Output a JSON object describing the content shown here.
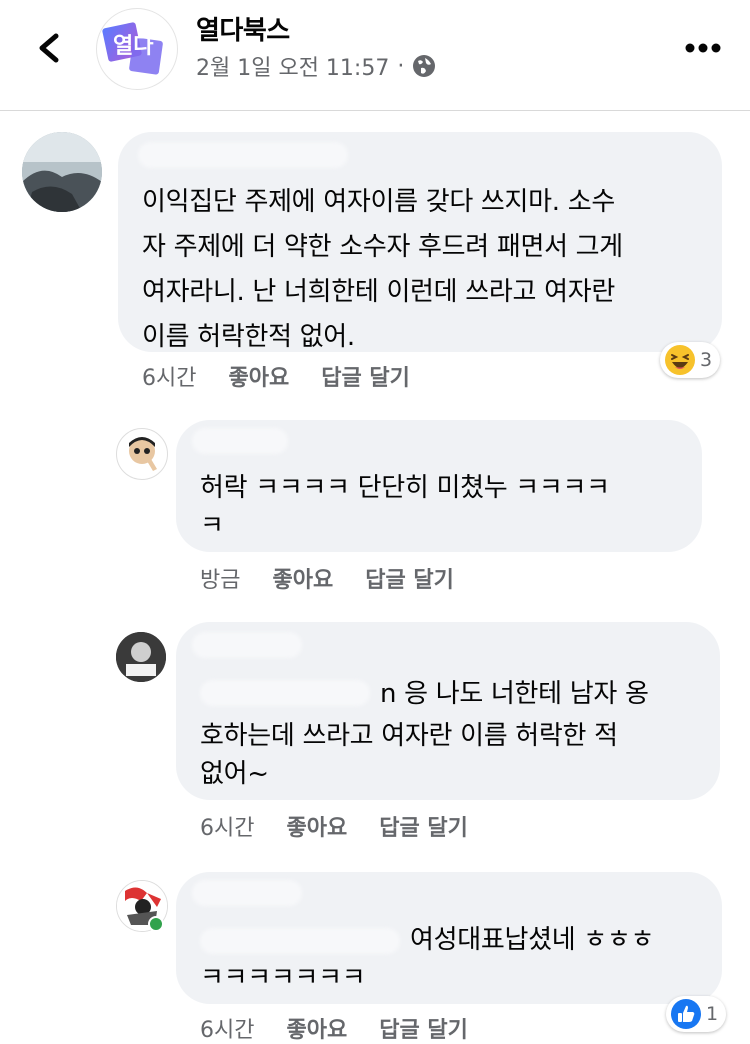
{
  "header": {
    "page_name": "열다북스",
    "timestamp": "2월 1일 오전 11:57",
    "separator": "·",
    "privacy_icon": "globe-icon",
    "back_icon": "chevron-left-icon",
    "more_icon": "more-horizontal-icon",
    "logo_text": "열다"
  },
  "comments": [
    {
      "text_lines": [
        "이익집단 주제에 여자이름 갖다 쓰지마. 소수",
        "자 주제에 더 약한 소수자 후드려 패면서 그게",
        "여자라니. 난  너희한테 이런데 쓰라고 여자란",
        "이름 허락한적 없어."
      ],
      "time": "6시간",
      "like_label": "좋아요",
      "reply_label": "답글 달기",
      "reaction": {
        "icon": "haha-emoji-icon",
        "count": "3"
      }
    },
    {
      "text_lines": [
        "허락 ㅋㅋㅋㅋ 단단히 미쳤누 ㅋㅋㅋㅋ",
        "ㅋ"
      ],
      "time": "방금",
      "like_label": "좋아요",
      "reply_label": "답글 달기"
    },
    {
      "text_lines": [
        "n 응 나도 너한테 남자 옹",
        "호하는데 쓰라고 여자란 이름 허락한 적",
        "없어~"
      ],
      "time": "6시간",
      "like_label": "좋아요",
      "reply_label": "답글 달기"
    },
    {
      "text_lines": [
        "여성대표납셨네 ㅎㅎㅎ",
        "ㅋㅋㅋㅋㅋㅋㅋ"
      ],
      "time": "6시간",
      "like_label": "좋아요",
      "reply_label": "답글 달기",
      "reaction": {
        "icon": "like-thumb-icon",
        "count": "1"
      }
    }
  ],
  "colors": {
    "bubble": "#f0f2f5",
    "meta_text": "#65676b",
    "like_blue": "#1877f2",
    "haha_yellow": "#f7c22b",
    "online_green": "#31a24c"
  }
}
